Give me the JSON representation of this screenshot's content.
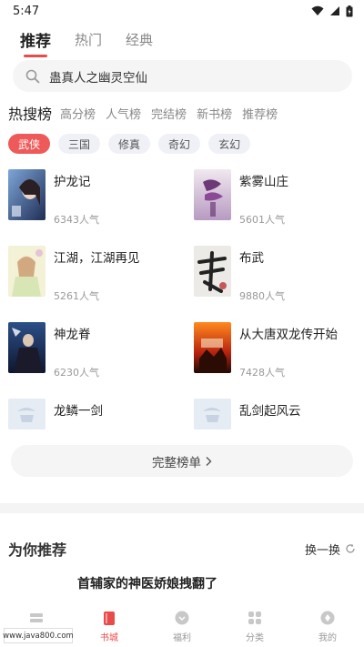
{
  "status": {
    "time": "5:47"
  },
  "tabs": [
    {
      "label": "推荐",
      "active": true
    },
    {
      "label": "热门",
      "active": false
    },
    {
      "label": "经典",
      "active": false
    }
  ],
  "search": {
    "text": "蛊真人之幽灵空仙"
  },
  "rank_tabs": [
    {
      "label": "热搜榜",
      "active": true
    },
    {
      "label": "高分榜"
    },
    {
      "label": "人气榜"
    },
    {
      "label": "完结榜"
    },
    {
      "label": "新书榜"
    },
    {
      "label": "推荐榜"
    }
  ],
  "chips": [
    {
      "label": "武侠",
      "active": true
    },
    {
      "label": "三国"
    },
    {
      "label": "修真"
    },
    {
      "label": "奇幻"
    },
    {
      "label": "玄幻"
    }
  ],
  "books": [
    {
      "title": "护龙记",
      "popularity": "6343人气",
      "cover": "blue-portrait"
    },
    {
      "title": "紫雾山庄",
      "popularity": "5601人气",
      "cover": "purple-mist"
    },
    {
      "title": "江湖，江湖再见",
      "popularity": "5261人气",
      "cover": "green-girl"
    },
    {
      "title": "布武",
      "popularity": "9880人气",
      "cover": "ink-calligraphy"
    },
    {
      "title": "神龙脊",
      "popularity": "6230人气",
      "cover": "dark-warrior"
    },
    {
      "title": "从大唐双龙传开始",
      "popularity": "7428人气",
      "cover": "fire-battle"
    },
    {
      "title": "龙鳞一剑",
      "popularity": "",
      "cover": "placeholder"
    },
    {
      "title": "乱剑起风云",
      "popularity": "",
      "cover": "placeholder"
    }
  ],
  "full_list_label": "完整榜单",
  "recommend": {
    "title": "为你推荐",
    "refresh_label": "换一换",
    "book_title": "首辅家的神医娇娘拽翻了"
  },
  "bottom_nav": [
    {
      "label": "",
      "icon": "bookshelf-icon"
    },
    {
      "label": "书城",
      "icon": "book-icon",
      "active": true
    },
    {
      "label": "福利",
      "icon": "gift-icon"
    },
    {
      "label": "分类",
      "icon": "category-icon"
    },
    {
      "label": "我的",
      "icon": "profile-icon"
    }
  ],
  "watermark": "www.java800.com",
  "colors": {
    "accent": "#e94b4b",
    "chip_bg": "#f0f1f7"
  }
}
